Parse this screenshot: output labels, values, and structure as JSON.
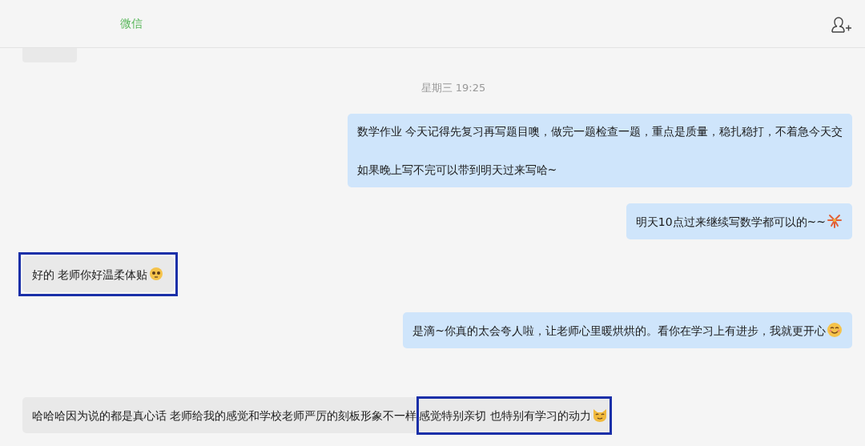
{
  "header": {
    "app_label": "微信"
  },
  "messages": [
    {
      "kind": "clipped"
    },
    {
      "kind": "time",
      "text": "星期三 19:25"
    },
    {
      "kind": "sent",
      "highlighted": false,
      "paragraphs": [
        "数学作业 今天记得先复习再写题目噢，做完一题检查一题，重点是质量，稳扎稳打，不着急今天交",
        "如果晚上写不完可以带到明天过来写哈~"
      ]
    },
    {
      "kind": "sent",
      "highlighted": false,
      "segments": [
        {
          "kind": "text",
          "text": "明天10点过来继续写数学都可以的~~",
          "highlighted": false
        },
        {
          "kind": "fireworks",
          "highlighted": false
        }
      ]
    },
    {
      "kind": "received",
      "highlighted": true,
      "segments": [
        {
          "kind": "text",
          "text": "好的 老师你好温柔体贴",
          "highlighted": false
        },
        {
          "kind": "face",
          "highlighted": false
        }
      ]
    },
    {
      "kind": "sent",
      "highlighted": false,
      "segments": [
        {
          "kind": "text",
          "text": "是滴~你真的太会夸人啦，让老师心里暖烘烘的。看你在学习上有进步，我就更开心",
          "highlighted": false
        },
        {
          "kind": "smile",
          "highlighted": false
        }
      ]
    },
    {
      "kind": "received",
      "highlighted": false,
      "segments": [
        {
          "kind": "text",
          "text": "哈哈哈因为说的都是真心话 老师给我的感觉和学校老师严厉的刻板形象不一样",
          "highlighted": false
        },
        {
          "kind": "text",
          "text": "感觉特别亲切 也特别有学习的动力",
          "highlighted": true
        },
        {
          "kind": "cat",
          "highlighted": true
        }
      ]
    }
  ]
}
